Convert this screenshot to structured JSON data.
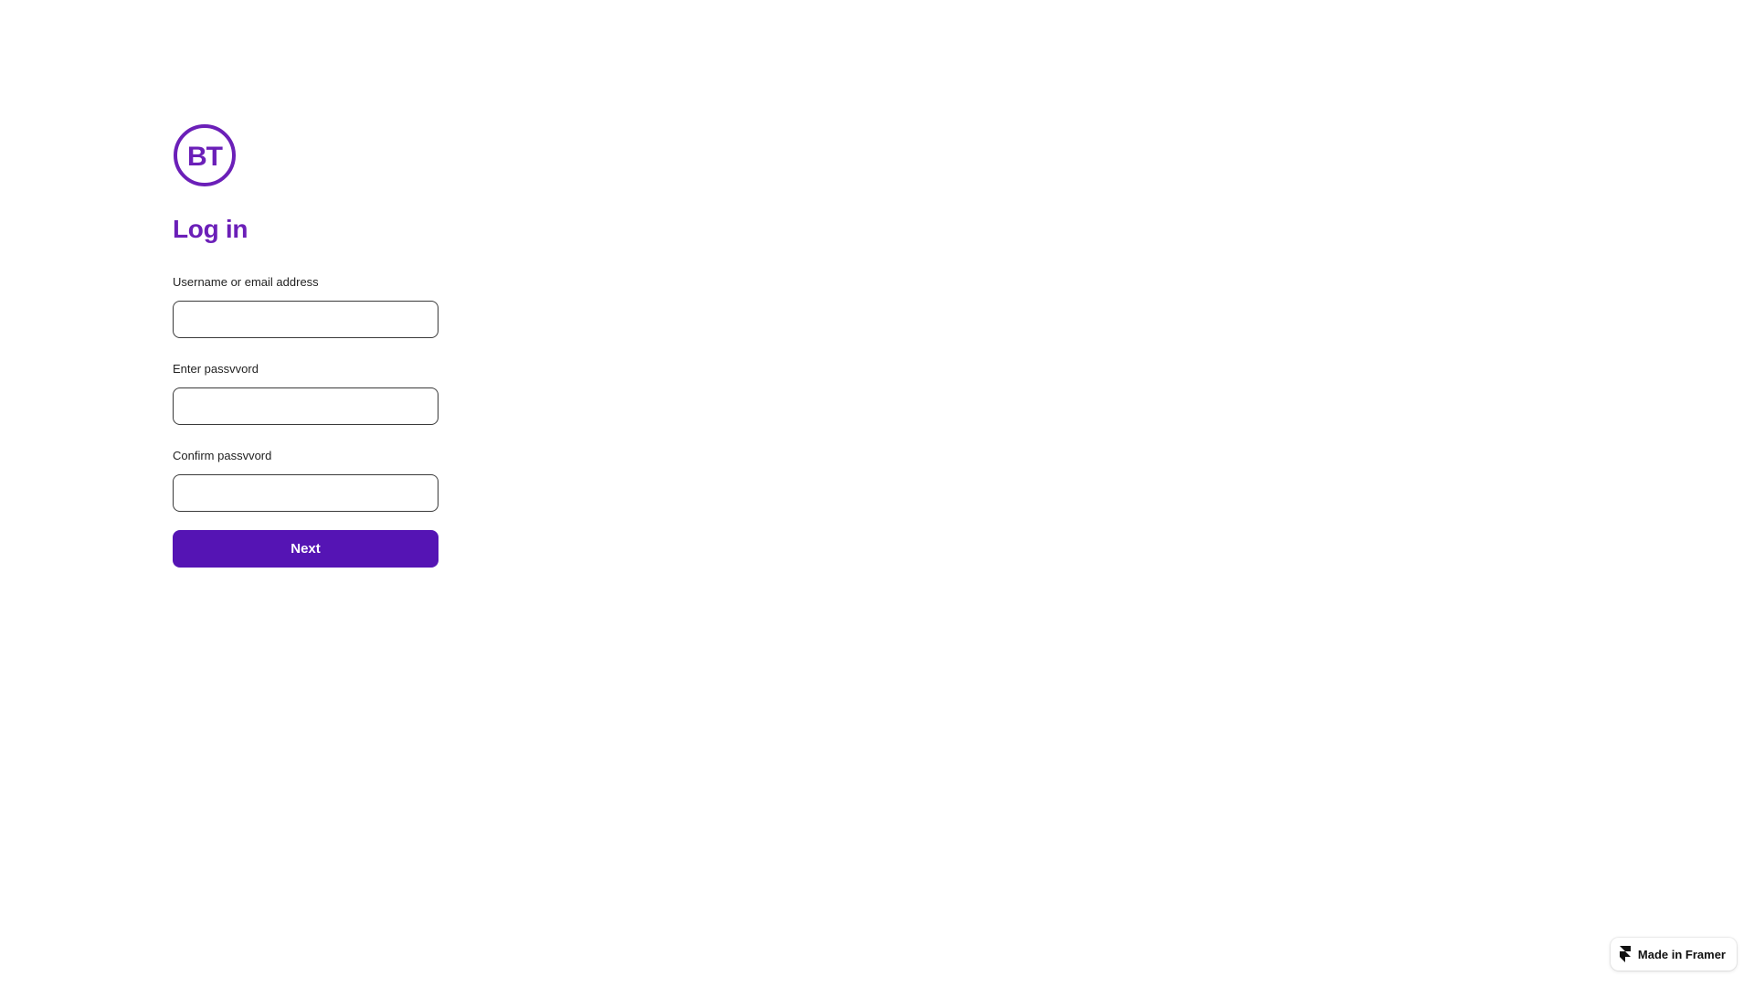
{
  "brand": {
    "logo_text": "BT",
    "color": "#6b1fb8",
    "button_color": "#5514b4"
  },
  "form": {
    "title": "Log in",
    "fields": [
      {
        "label": "Username or email address",
        "value": "",
        "placeholder": ""
      },
      {
        "label": "Enter passvvord",
        "value": "",
        "placeholder": ""
      },
      {
        "label": "Confirm passvvord",
        "value": "",
        "placeholder": ""
      }
    ],
    "submit_label": "Next"
  },
  "badge": {
    "label": "Made in Framer",
    "icon": "framer-icon"
  }
}
